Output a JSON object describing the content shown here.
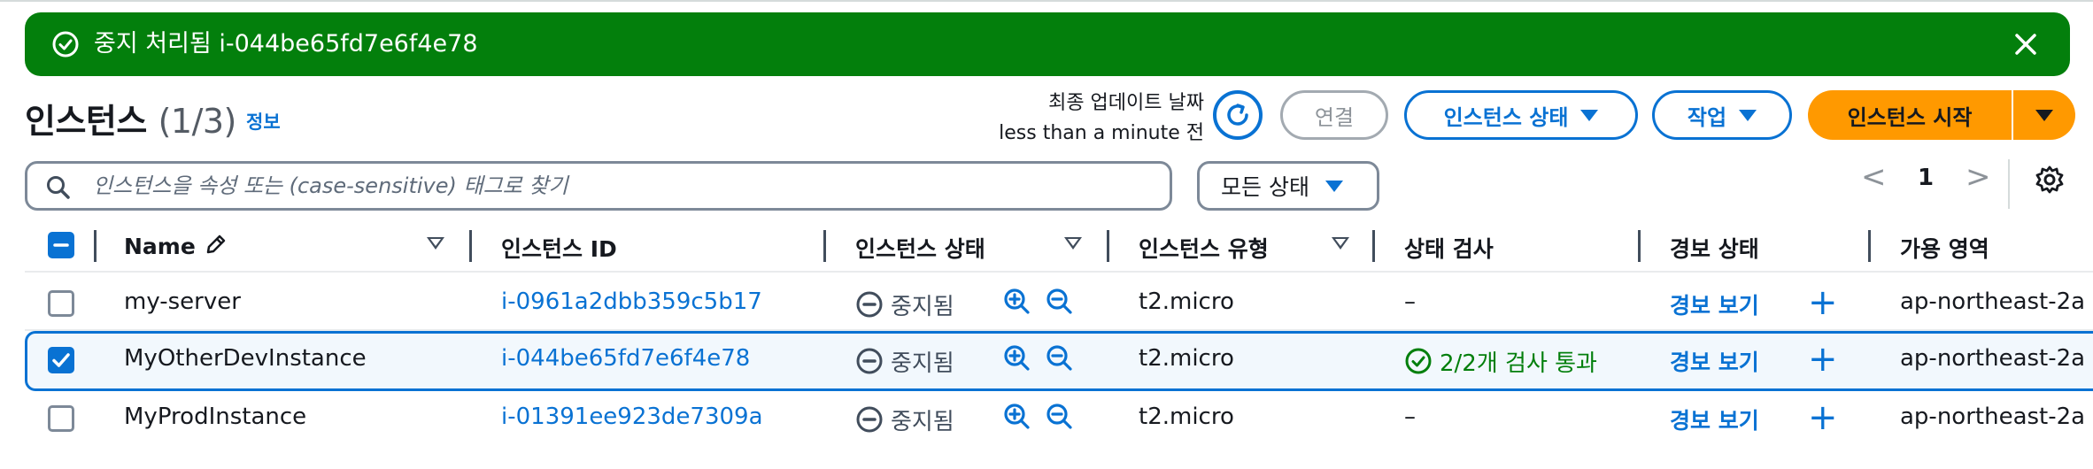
{
  "flash": {
    "message": "중지 처리됨 i-044be65fd7e6f4e78",
    "status_icon": "check-circle-icon",
    "close_icon": "close-icon"
  },
  "header": {
    "title": "인스턴스",
    "count": "(1/3)",
    "info_link": "정보",
    "last_updated_label": "최종 업데이트 날짜",
    "last_updated_value": "less than a minute 전"
  },
  "toolbar": {
    "connect": "연결",
    "instance_state": "인스턴스 상태",
    "actions": "작업",
    "launch": "인스턴스 시작"
  },
  "filter": {
    "search_placeholder": "인스턴스을 속성 또는 (case-sensitive) 태그로 찾기",
    "state_select": "모든 상태"
  },
  "pagination": {
    "prev": "<",
    "current": "1",
    "next": ">"
  },
  "table": {
    "columns": {
      "name": "Name",
      "instance_id": "인스턴스 ID",
      "instance_state": "인스턴스 상태",
      "instance_type": "인스턴스 유형",
      "status_check": "상태 검사",
      "alarm_status": "경보 상태",
      "availability_zone": "가용 영역"
    },
    "rows": [
      {
        "selected": false,
        "name": "my-server",
        "instance_id": "i-0961a2dbb359c5b17",
        "state": "중지됨",
        "type": "t2.micro",
        "status_check": "–",
        "alarm": "경보 보기",
        "az": "ap-northeast-2a"
      },
      {
        "selected": true,
        "name": "MyOtherDevInstance",
        "instance_id": "i-044be65fd7e6f4e78",
        "state": "중지됨",
        "type": "t2.micro",
        "status_check": "2/2개 검사 통과",
        "alarm": "경보 보기",
        "az": "ap-northeast-2a"
      },
      {
        "selected": false,
        "name": "MyProdInstance",
        "instance_id": "i-01391ee923de7309a",
        "state": "중지됨",
        "type": "t2.micro",
        "status_check": "–",
        "alarm": "경보 보기",
        "az": "ap-northeast-2a"
      }
    ]
  },
  "colors": {
    "success": "#037f0c",
    "link": "#0972d3",
    "primary": "#ff9900"
  }
}
